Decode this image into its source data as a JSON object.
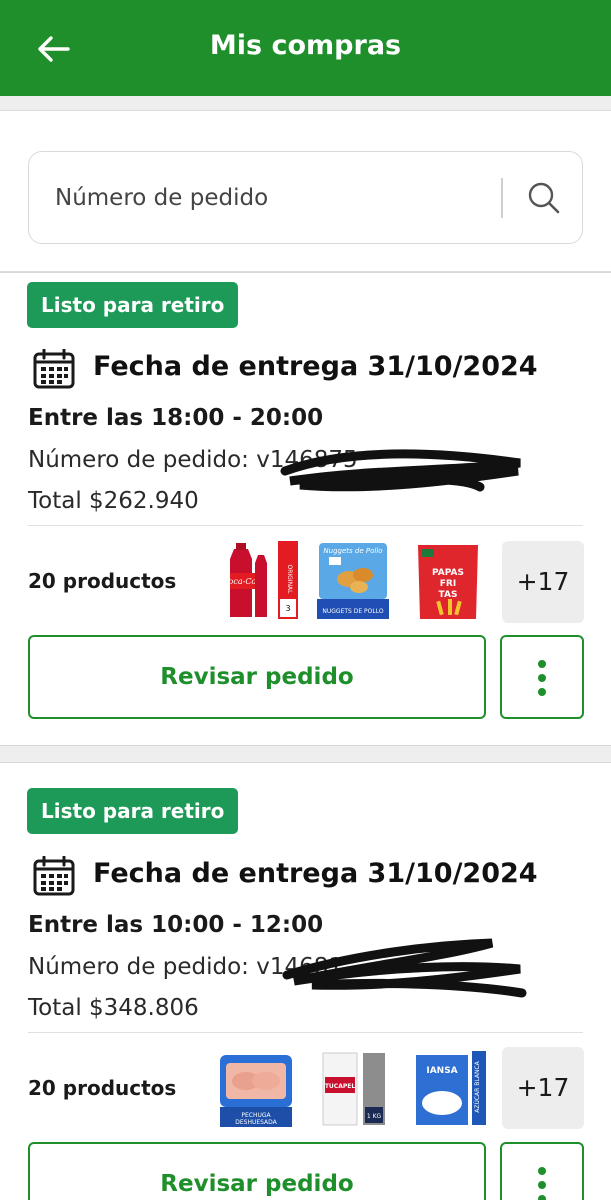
{
  "app": {
    "title": "Mis compras",
    "accent": "#1e8f2b",
    "badge_color": "#1e9a58"
  },
  "search": {
    "placeholder": "Número de pedido"
  },
  "orders": [
    {
      "status": "Listo para retiro",
      "date_label": "Fecha de entrega 31/10/2024",
      "time_window": "Entre las 18:00 - 20:00",
      "order_number": "Número de pedido: v146875",
      "total": "Total $262.940",
      "product_count": "20  productos",
      "thumbnails": [
        {
          "icon": "coca-cola-bottle",
          "text": "Coca-Cola"
        },
        {
          "icon": "nuggets-bag",
          "text": "Nuggets de Pollo"
        },
        {
          "icon": "papas-fritas-bag",
          "text": "PAPAS FRITAS"
        }
      ],
      "more": "+17",
      "review_label": "Revisar pedido"
    },
    {
      "status": "Listo para retiro",
      "date_label": "Fecha de entrega 31/10/2024",
      "time_window": "Entre las 10:00 - 12:00",
      "order_number": "Número de pedido: v14681",
      "total": "Total $348.806",
      "product_count": "20  productos",
      "thumbnails": [
        {
          "icon": "chicken-breast-tray",
          "text": "PECHUGA DESHUESADA"
        },
        {
          "icon": "rice-bag",
          "text": "TUCAPEL"
        },
        {
          "icon": "sugar-bag",
          "text": "IANSA"
        }
      ],
      "more": "+17",
      "review_label": "Revisar pedido"
    }
  ]
}
